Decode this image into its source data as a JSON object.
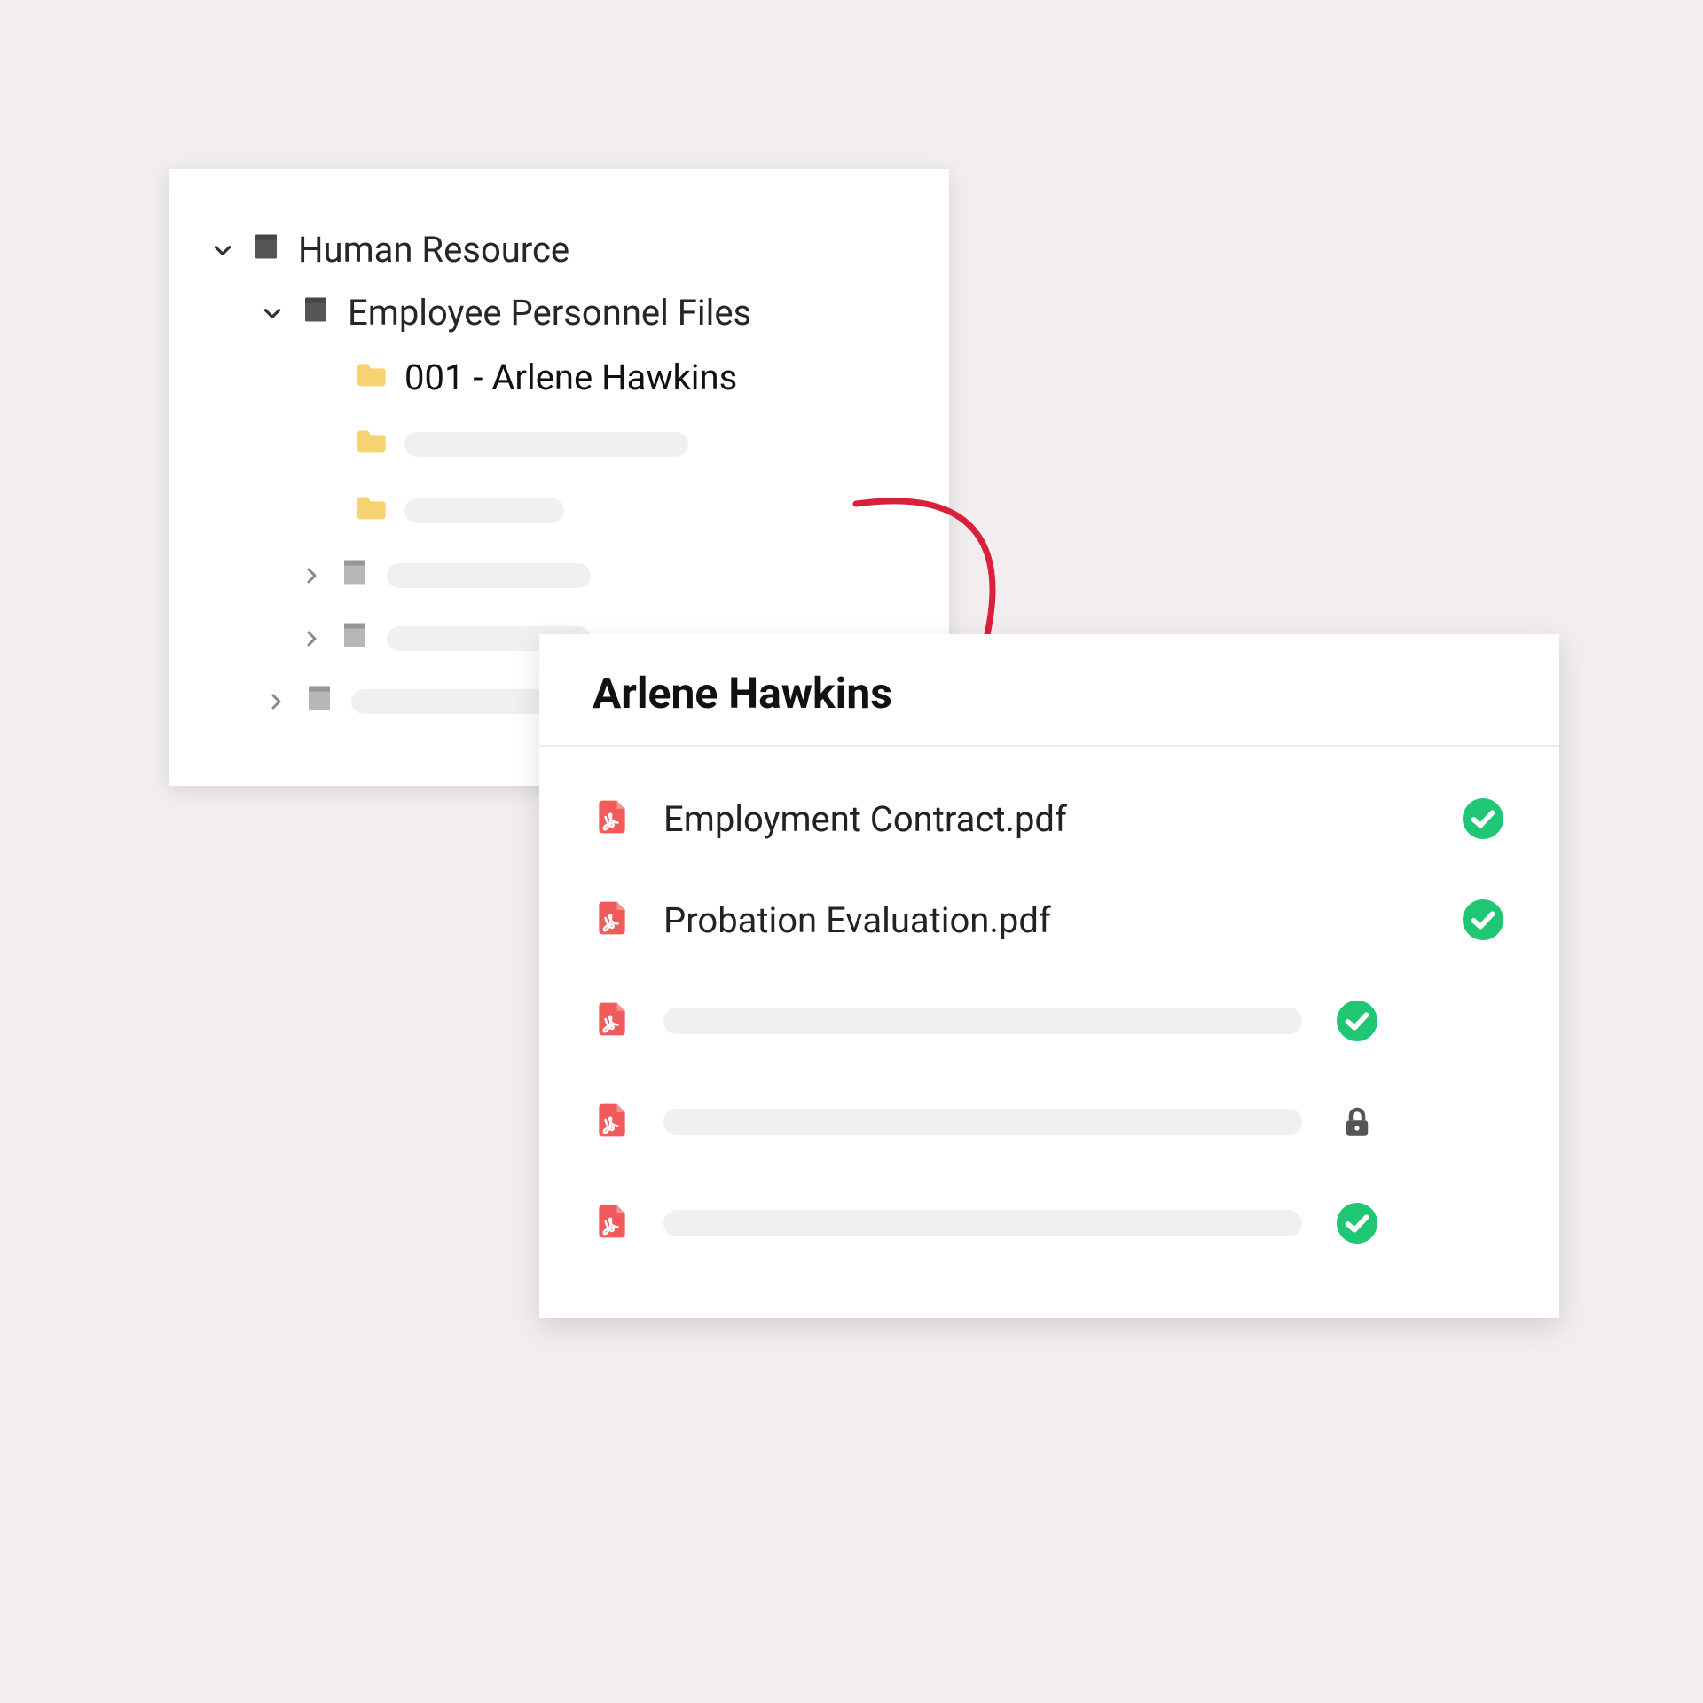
{
  "tree": {
    "root": {
      "label": "Human Resource",
      "expanded": true
    },
    "child": {
      "label": "Employee Personnel Files",
      "expanded": true
    },
    "selected_folder": {
      "label": "001 - Arlene Hawkins"
    }
  },
  "detail": {
    "title": "Arlene Hawkins",
    "files": [
      {
        "name": "Employment Contract.pdf",
        "status": "check"
      },
      {
        "name": "Probation Evaluation.pdf",
        "status": "check"
      },
      {
        "name": null,
        "status": "check"
      },
      {
        "name": null,
        "status": "lock"
      },
      {
        "name": null,
        "status": "check"
      }
    ]
  },
  "colors": {
    "accent": "#d9203d",
    "check": "#1fc774",
    "folder": "#f5d272",
    "pdf": "#f15b5b",
    "book": "#555555",
    "book_muted": "#b7b7b7"
  }
}
